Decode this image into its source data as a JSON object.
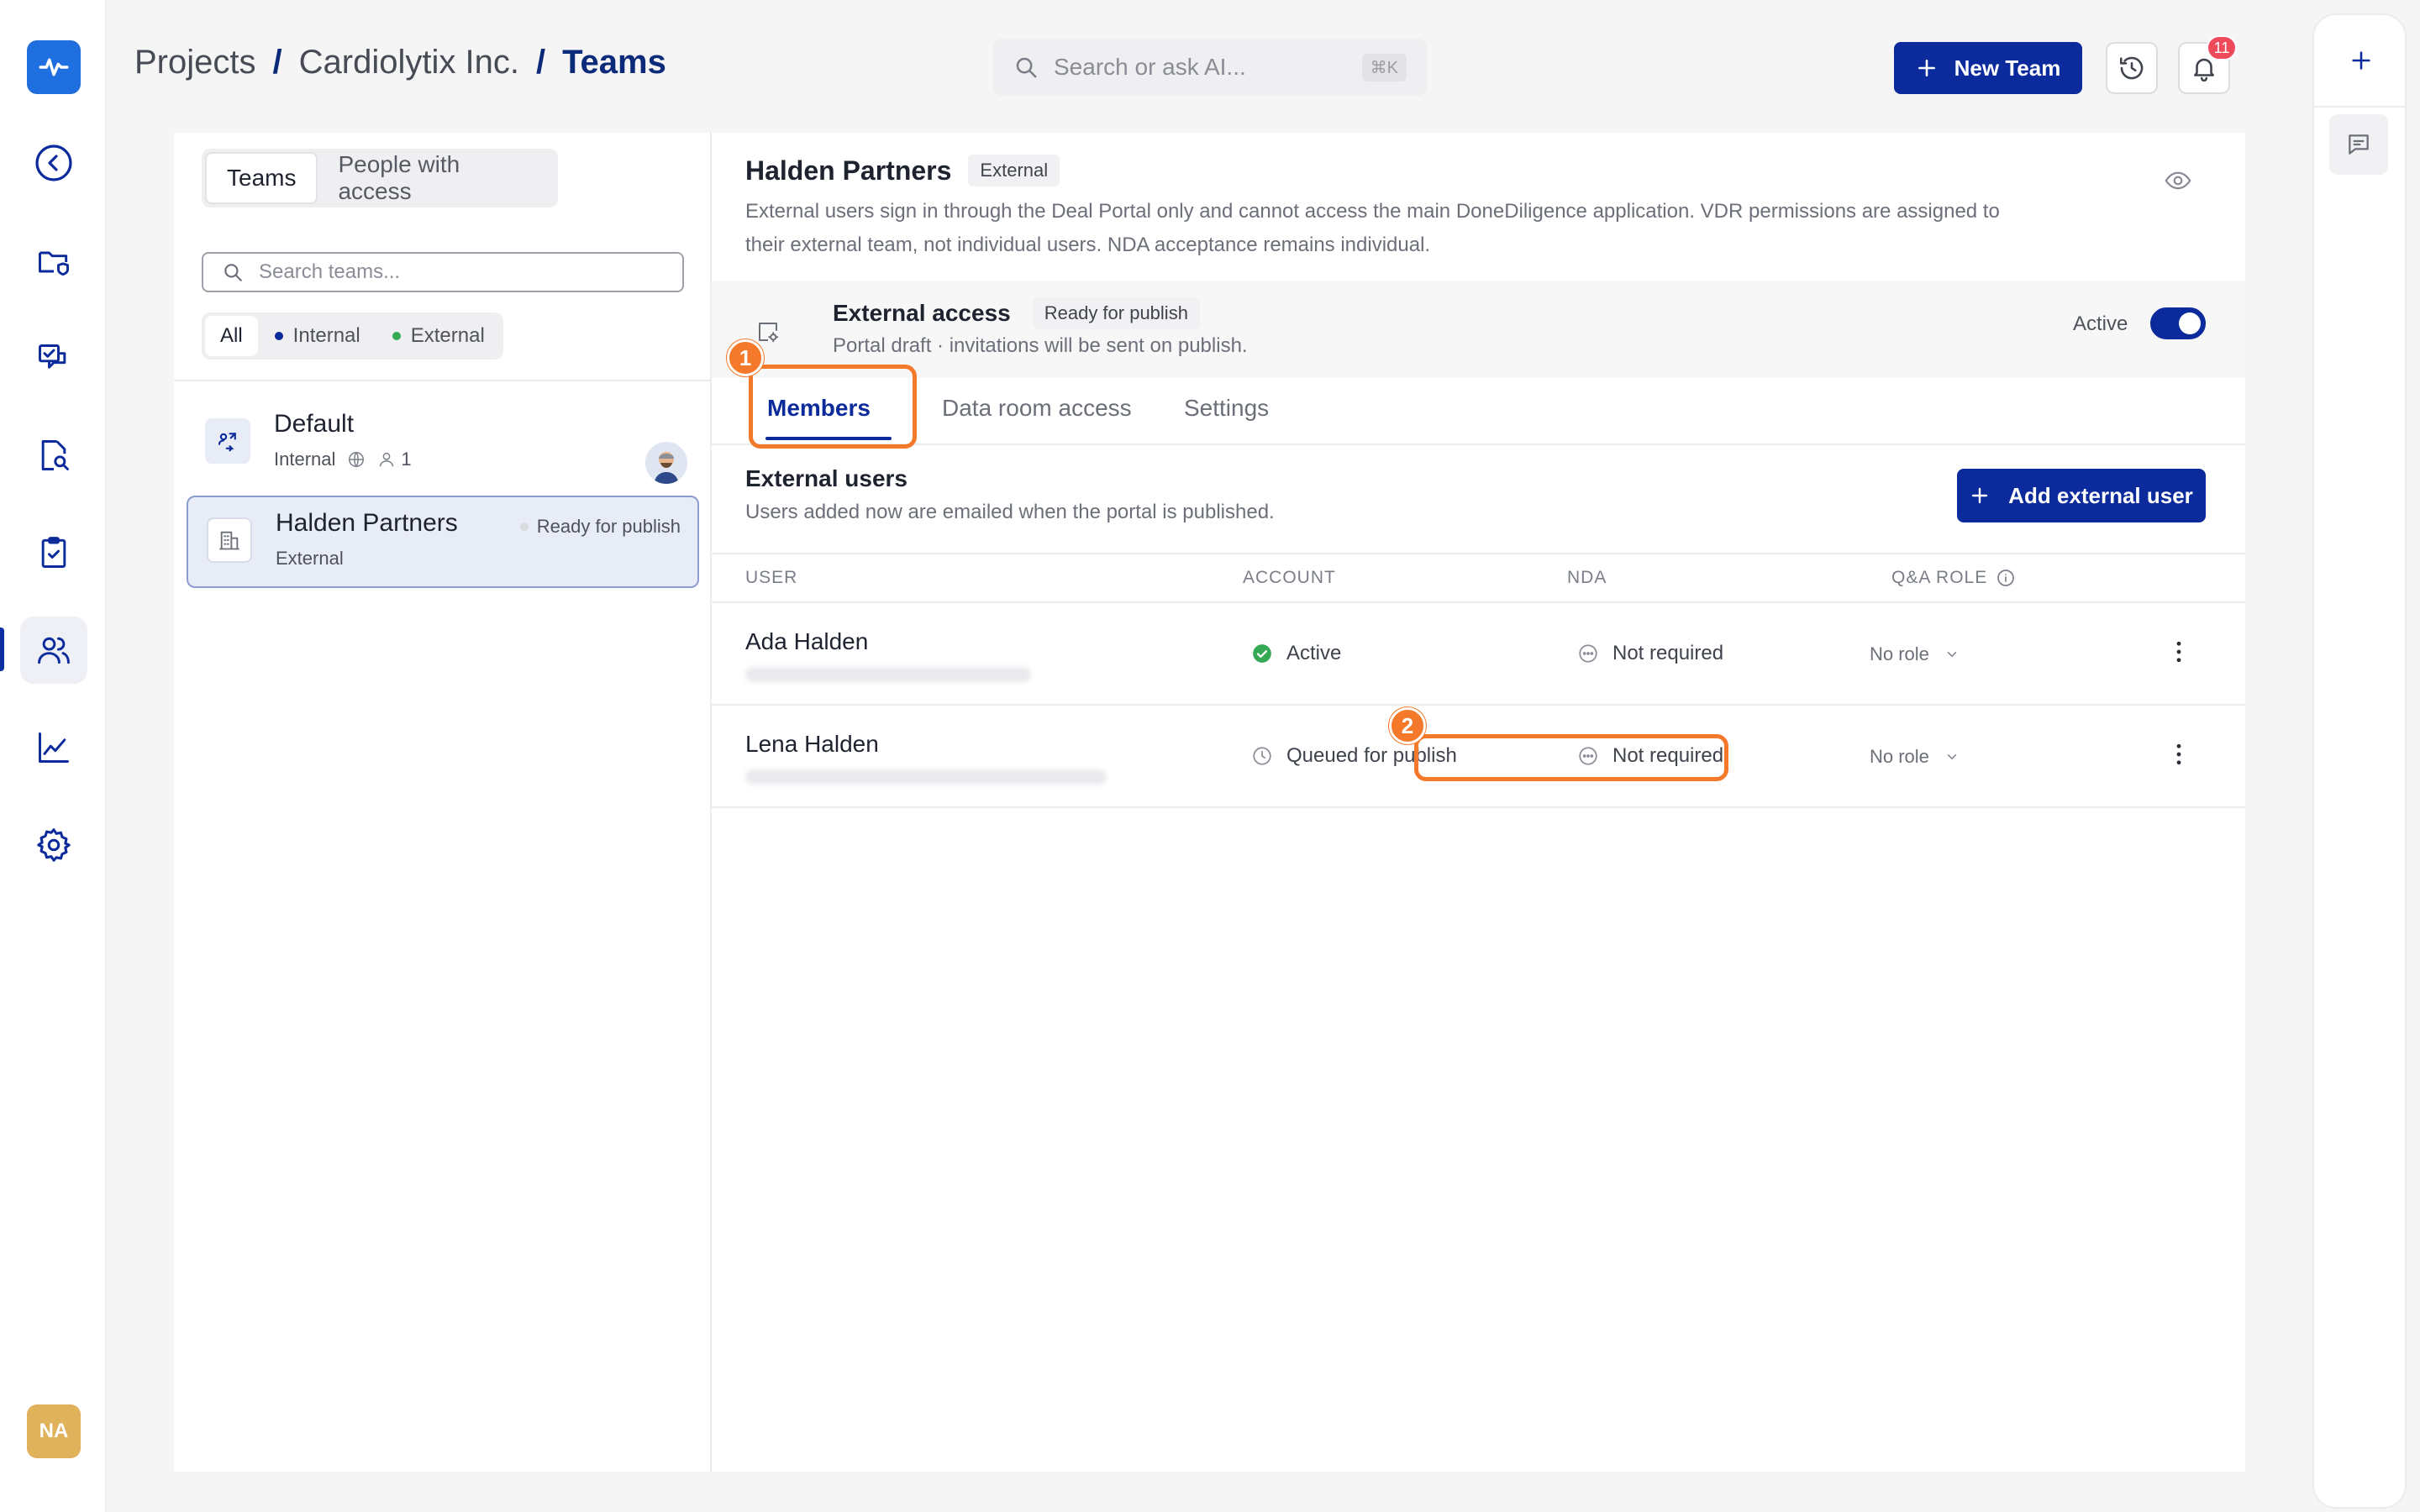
{
  "rail": {
    "avatar_initials": "NA"
  },
  "header": {
    "breadcrumb": [
      "Projects",
      "Cardiolytix Inc.",
      "Teams"
    ],
    "separator": "/",
    "search_placeholder": "Search or ask AI...",
    "search_shortcut": "⌘K",
    "new_team_label": "New Team",
    "notification_count": "11"
  },
  "teams_panel": {
    "segments": [
      "Teams",
      "People with access"
    ],
    "search_placeholder": "Search teams...",
    "filters": [
      {
        "label": "All"
      },
      {
        "label": "Internal",
        "dot_color": "#0b2a9c"
      },
      {
        "label": "External",
        "dot_color": "#35a853"
      }
    ],
    "teams": [
      {
        "name": "Default",
        "type": "Internal",
        "member_count": "1"
      },
      {
        "name": "Halden Partners",
        "type": "External",
        "status": "Ready for publish"
      }
    ]
  },
  "detail": {
    "title": "Halden Partners",
    "badge": "External",
    "description": "External users sign in through the Deal Portal only and cannot access the main DoneDiligence application. VDR permissions are assigned to their external team, not individual users. NDA acceptance remains individual.",
    "external_access": {
      "title": "External access",
      "status": "Ready for publish",
      "subtitle": "Portal draft · invitations will be sent on publish.",
      "toggle_label": "Active",
      "toggle_on": true
    },
    "tabs": [
      "Members",
      "Data room access",
      "Settings"
    ],
    "active_tab": "Members",
    "callouts": [
      "1",
      "2"
    ],
    "external_users": {
      "title": "External users",
      "subtitle": "Users added now are emailed when the portal is published.",
      "add_label": "Add external user"
    },
    "columns": [
      "USER",
      "ACCOUNT",
      "NDA",
      "Q&A ROLE"
    ],
    "rows": [
      {
        "name": "Ada Halden",
        "account": "Active",
        "nda": "Not required",
        "role": "No role"
      },
      {
        "name": "Lena Halden",
        "account": "Queued for publish",
        "nda": "Not required",
        "role": "No role"
      }
    ]
  },
  "colors": {
    "brand": "#0b2a9c",
    "callout": "#f5792a",
    "active_green": "#35a853",
    "notification": "#ee4a5a"
  }
}
